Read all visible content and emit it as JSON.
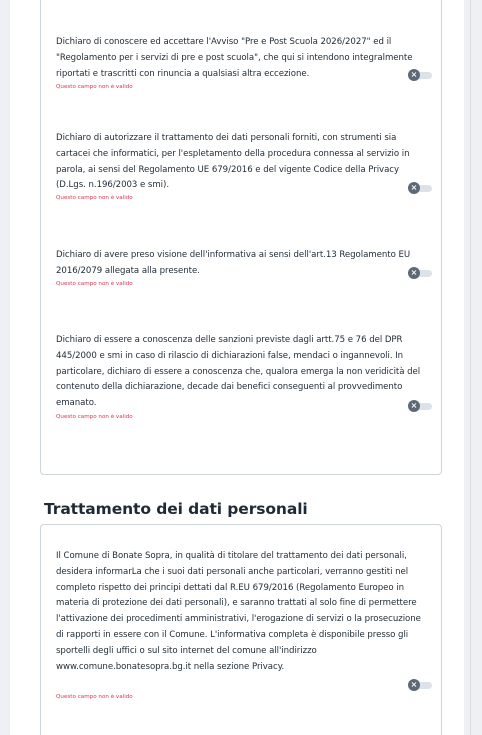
{
  "declarations": [
    {
      "text": "Dichiaro di conoscere ed accettare l'Avviso \"Pre e Post Scuola 2026/2027\" ed il \"Regolamento per i servizi di pre e post scuola\", che qui si intendono integralmente riportati e trascritti con rinuncia a qualsiasi altra eccezione.",
      "error": "Questo campo non è valido",
      "toggle_state": "off"
    },
    {
      "text": "Dichiaro di autorizzare il trattamento dei dati personali forniti, con strumenti sia cartacei che informatici, per l'espletamento della procedura connessa al servizio in parola, ai sensi del Regolamento UE 679/2016 e del vigente Codice della Privacy (D.Lgs. n.196/2003 e smi).",
      "error": "Questo campo non è valido",
      "toggle_state": "off"
    },
    {
      "text": "Dichiaro di avere preso visione dell'informativa ai sensi dell'art.13 Regolamento EU 2016/2079 allegata alla presente.",
      "error": "Questo campo non è valido",
      "toggle_state": "off"
    },
    {
      "text": "Dichiaro di essere a conoscenza delle sanzioni previste dagli artt.75 e 76 del DPR 445/2000 e smi in caso di rilascio di dichiarazioni false, mendaci o ingannevoli. In particolare, dichiaro di essere a conoscenza che, qualora emerga la non veridicità del contenuto della dichiarazione, decade dai benefici conseguenti al provvedimento emanato.",
      "error": "Questo campo non è valido",
      "toggle_state": "off"
    }
  ],
  "privacy_section": {
    "title": "Trattamento dei dati personali",
    "text": "Il Comune di Bonate Sopra, in qualità di titolare del trattamento dei dati personali, desidera informarLa che i suoi dati personali anche particolari, verranno gestiti nel completo rispetto dei principi dettati dal R.EU 679/2016 (Regolamento Europeo in materia di protezione dei dati personali), e saranno trattati al solo fine di permettere l'attivazione dei procedimenti amministrativi, l'erogazione di servizi o la prosecuzione di rapporti in essere con il Comune. L'informativa completa è disponibile presso gli sportelli degli uffici o sul sito internet del comune all'indirizzo www.comune.bonatesopra.bg.it nella sezione Privacy.",
    "error": "Questo campo non è valido",
    "toggle_state": "off"
  },
  "icons": {
    "toggle_off": "close-icon"
  },
  "colors": {
    "error": "#d9364f",
    "toggle_knob": "#5d6976",
    "toggle_track": "#dde2e8",
    "border": "#cfd5dc"
  }
}
